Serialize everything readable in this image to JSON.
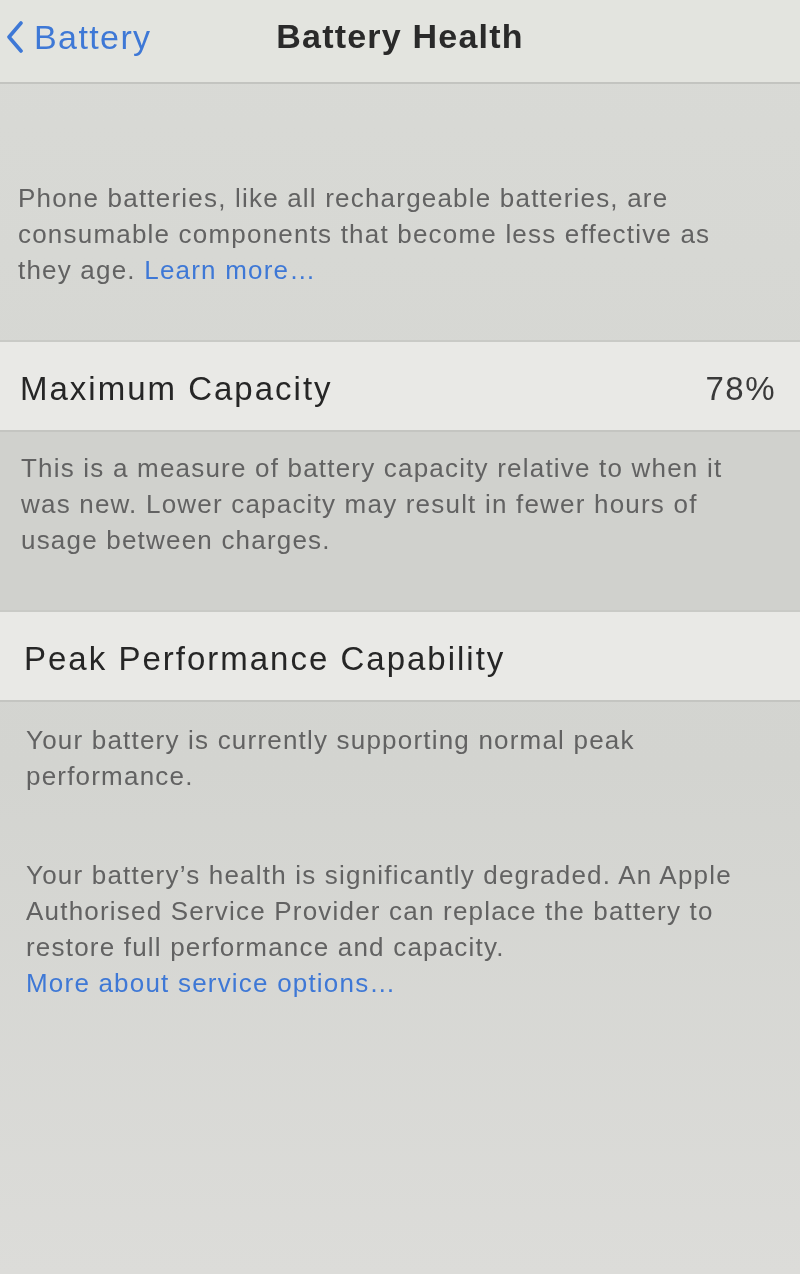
{
  "nav": {
    "back_label": "Battery",
    "title": "Battery Health"
  },
  "intro": {
    "text": "Phone batteries, like all rechargeable batteries, are consumable components that become less effective as they age.",
    "link": "Learn more…"
  },
  "sections": [
    {
      "label": "Maximum Capacity",
      "value": "78%",
      "footer": [
        {
          "text": "This is a measure of battery capacity relative to when it was new. Lower capacity may result in fewer hours of usage between charges."
        }
      ]
    },
    {
      "label": "Peak Performance Capability",
      "footer": [
        {
          "text": "Your battery is currently supporting normal peak performance."
        },
        {
          "text": "Your battery’s health is significantly degraded. An Apple Authorised Service Provider can replace the battery to restore full performance and capacity.",
          "link": "More about service options…"
        }
      ]
    }
  ]
}
